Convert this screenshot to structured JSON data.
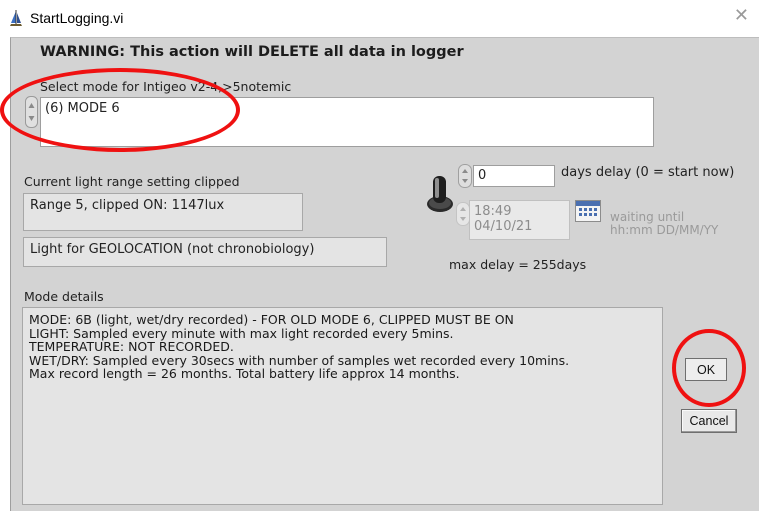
{
  "window": {
    "title": "StartLogging.vi",
    "close_glyph": "✕",
    "icon": "app-icon"
  },
  "warning": "WARNING: This action will DELETE all data in logger",
  "mode_select": {
    "label": "Select mode for Intigeo v2-4,>5notemic",
    "value": "(6) MODE 6"
  },
  "light_range": {
    "label": "Current light range setting clipped",
    "value": "Range 5, clipped ON: 1147lux",
    "purpose": "Light for GEOLOCATION (not chronobiology)"
  },
  "delay": {
    "days_value": "0",
    "days_label": "days delay (0 = start now)",
    "time": "18:49",
    "date": "04/10/21",
    "waiting_line1": "waiting until",
    "waiting_line2": "hh:mm DD/MM/YY",
    "max_delay": "max delay = 255days"
  },
  "mode_details": {
    "label": "Mode details",
    "lines": [
      "MODE: 6B (light, wet/dry recorded) - FOR OLD MODE 6, CLIPPED MUST BE ON",
      "LIGHT: Sampled every minute with max light recorded every 5mins.",
      "TEMPERATURE: NOT RECORDED.",
      "WET/DRY: Sampled every 30secs with number of samples wet recorded every 10mins.",
      "Max record length = 26 months. Total battery life approx 14 months."
    ]
  },
  "buttons": {
    "ok": "OK",
    "cancel": "Cancel"
  },
  "colors": {
    "panel": "#d3d3d3",
    "field": "#e4e4e4",
    "annotation": "#ef1111",
    "calendar": "#4a6fb0"
  }
}
